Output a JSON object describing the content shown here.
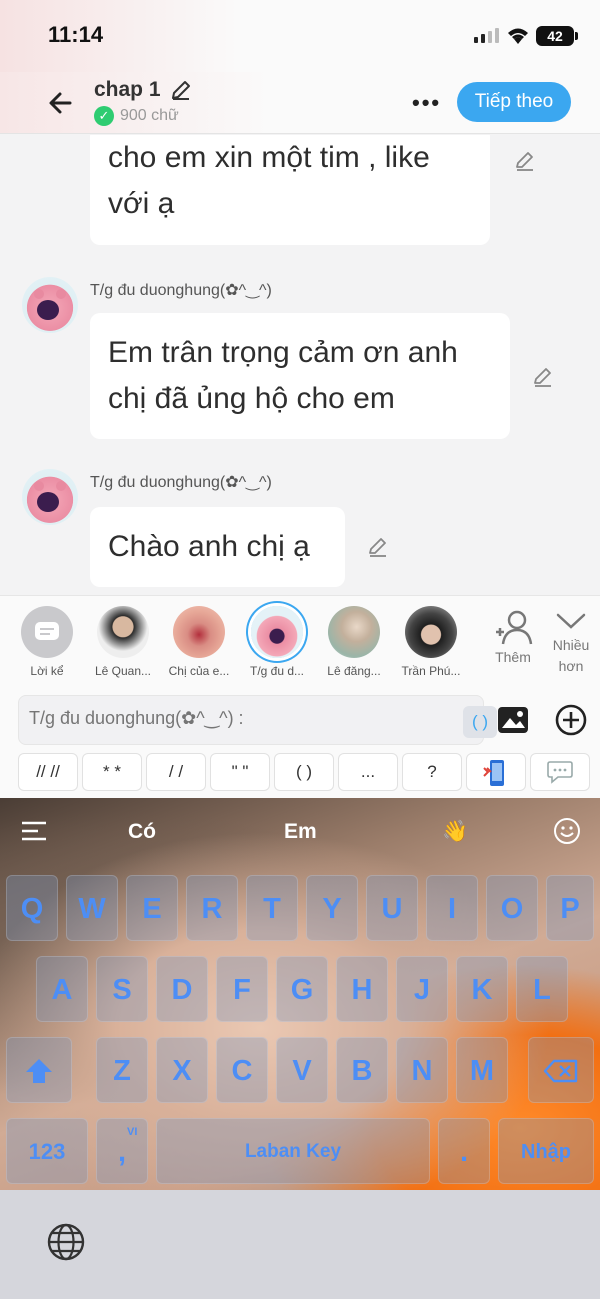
{
  "status_bar": {
    "time": "11:14",
    "battery": "42"
  },
  "header": {
    "title": "chap 1",
    "word_count": "900 chữ",
    "next_button": "Tiếp theo"
  },
  "messages": [
    {
      "text_lines": [
        "cho em xin một tim , like",
        "với ạ"
      ]
    },
    {
      "author": "T/g đu duonghung(✿^‿^)",
      "text_lines": [
        "Em trân trọng cảm ơn anh",
        "chị đã ủng hộ cho em"
      ]
    },
    {
      "author": "T/g đu duonghung(✿^‿^)",
      "text_lines": [
        "Chào anh chị ạ"
      ]
    }
  ],
  "characters": [
    {
      "label": "Lời kể"
    },
    {
      "label": "Lê Quan..."
    },
    {
      "label": "Chị của e..."
    },
    {
      "label": "T/g đu d..."
    },
    {
      "label": "Lê đăng..."
    },
    {
      "label": "Trần Phú..."
    }
  ],
  "add_character": "Thêm",
  "more": "Nhiều hơn",
  "input": {
    "placeholder": "T/g đu duonghung(✿^‿^) :",
    "paren": "( )"
  },
  "symbols": [
    "// //",
    "* *",
    "/ /",
    "\" \"",
    "( )",
    "...",
    "?"
  ],
  "keyboard": {
    "suggestions": [
      "Có",
      "Em"
    ],
    "emoji": "👋",
    "row1": [
      "Q",
      "W",
      "E",
      "R",
      "T",
      "Y",
      "U",
      "I",
      "O",
      "P"
    ],
    "row2": [
      "A",
      "S",
      "D",
      "F",
      "G",
      "H",
      "J",
      "K",
      "L"
    ],
    "row3": [
      "Z",
      "X",
      "C",
      "V",
      "B",
      "N",
      "M"
    ],
    "num_key": "123",
    "comma": ",",
    "vi_hint": "VI",
    "space": "Laban Key",
    "period": ".",
    "enter": "Nhập"
  },
  "colors": {
    "accent": "#3ba7f0",
    "key_text": "#4d8ef5",
    "success": "#2ecc71"
  }
}
